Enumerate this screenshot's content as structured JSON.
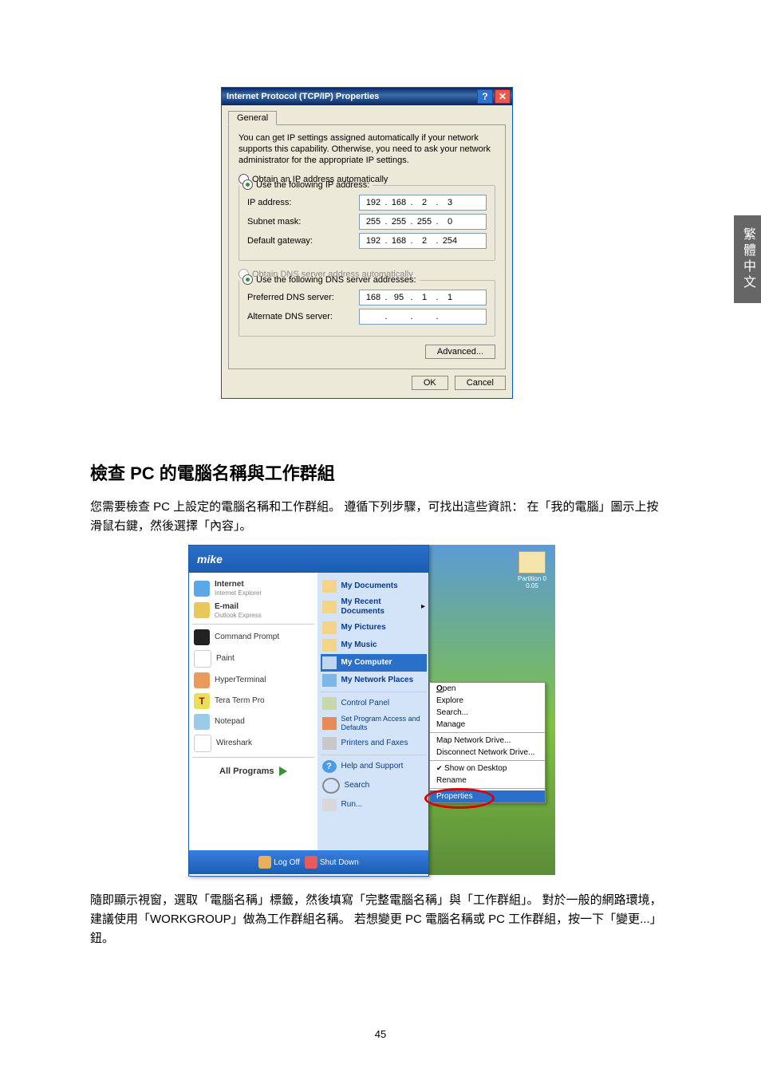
{
  "side_tab": "繁體中文",
  "dlg": {
    "title": "Internet Protocol (TCP/IP) Properties",
    "tab": "General",
    "info": "You can get IP settings assigned automatically if your network supports this capability. Otherwise, you need to ask your network administrator for the appropriate IP settings.",
    "r_auto_ip": "Obtain an IP address automatically",
    "r_use_ip": "Use the following IP address:",
    "lbl_ip": "IP address:",
    "lbl_mask": "Subnet mask:",
    "lbl_gw": "Default gateway:",
    "ip": [
      "192",
      "168",
      "2",
      "3"
    ],
    "mask": [
      "255",
      "255",
      "255",
      "0"
    ],
    "gw": [
      "192",
      "168",
      "2",
      "254"
    ],
    "r_auto_dns": "Obtain DNS server address automatically",
    "r_use_dns": "Use the following DNS server addresses:",
    "lbl_pdns": "Preferred DNS server:",
    "lbl_adns": "Alternate DNS server:",
    "pdns": [
      "168",
      "95",
      "1",
      "1"
    ],
    "adns": [
      "",
      "",
      "",
      ""
    ],
    "advanced": "Advanced...",
    "ok": "OK",
    "cancel": "Cancel"
  },
  "heading": "檢查 PC 的電腦名稱與工作群組",
  "para1": "您需要檢查 PC 上設定的電腦名稱和工作群組。 遵循下列步驟，可找出這些資訊： 在「我的電腦」圖示上按滑鼠右鍵，然後選擇「內容」。",
  "para2": "隨即顯示視窗，選取「電腦名稱」標籤，然後填寫「完整電腦名稱」與「工作群組」。 對於一般的網路環境，建議使用「WORKGROUP」做為工作群組名稱。 若想變更 PC 電腦名稱或 PC 工作群組，按一下「變更...」鈕。",
  "start": {
    "user": "mike",
    "recycle": "Partition 0\n0.05",
    "left": {
      "internet": "Internet",
      "internet_sub": "Internet Explorer",
      "email": "E-mail",
      "email_sub": "Outlook Express",
      "cmd": "Command Prompt",
      "paint": "Paint",
      "hyper": "HyperTerminal",
      "tera": "Tera Term Pro",
      "notepad": "Notepad",
      "wireshark": "Wireshark",
      "allprog": "All Programs"
    },
    "right": {
      "docs": "My Documents",
      "recent": "My Recent Documents",
      "pics": "My Pictures",
      "music": "My Music",
      "comp": "My Computer",
      "net": "My Network Places",
      "cp": "Control Panel",
      "spa": "Set Program Access and Defaults",
      "pf": "Printers and Faxes",
      "help": "Help and Support",
      "search": "Search",
      "run": "Run..."
    },
    "foot": {
      "logoff": "Log Off",
      "shutdown": "Shut Down"
    }
  },
  "ctx": {
    "open": "Open",
    "explore": "Explore",
    "search": "Search...",
    "manage": "Manage",
    "map": "Map Network Drive...",
    "disc": "Disconnect Network Drive...",
    "show": "Show on Desktop",
    "rename": "Rename",
    "props": "Properties"
  },
  "pagenum": "45"
}
